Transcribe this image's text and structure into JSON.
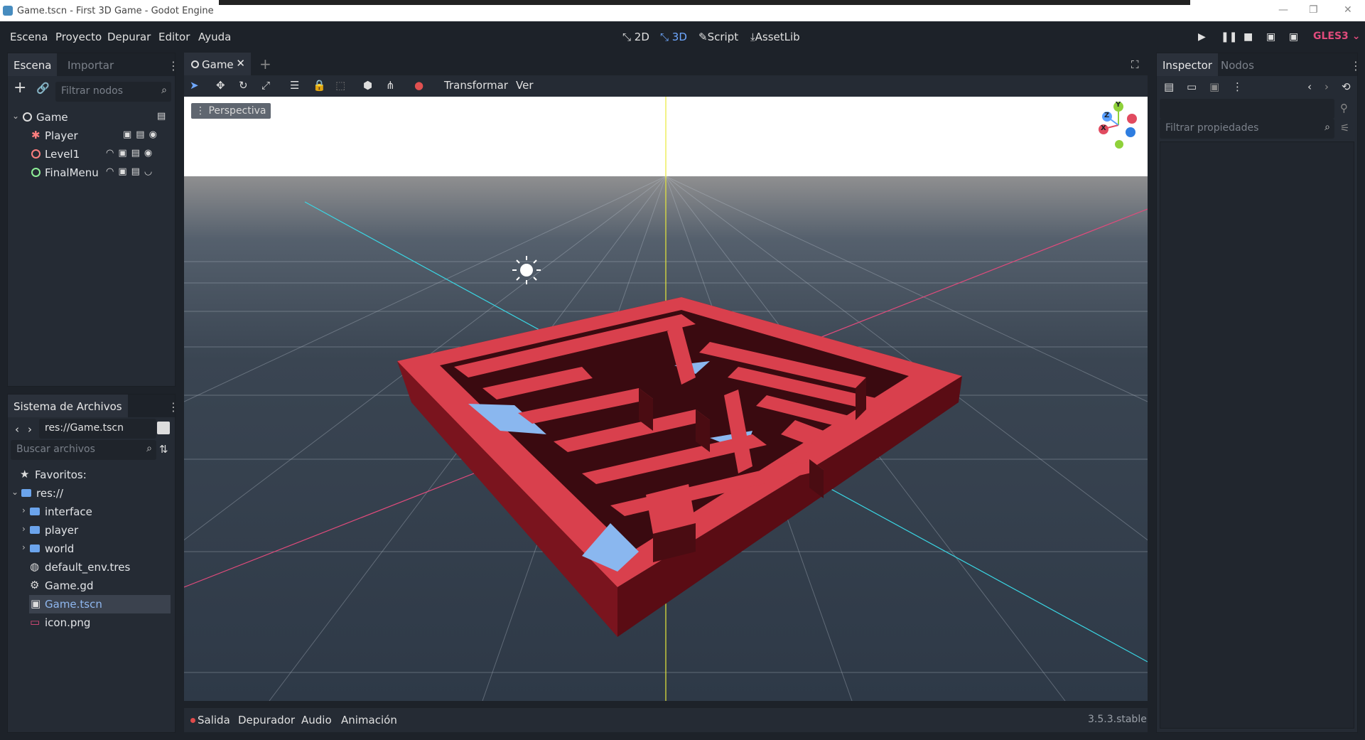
{
  "window": {
    "title": "Game.tscn - First 3D Game - Godot Engine",
    "controls": [
      "—",
      "❐",
      "✕"
    ]
  },
  "menu": [
    "Escena",
    "Proyecto",
    "Depurar",
    "Editor",
    "Ayuda"
  ],
  "workspaces": {
    "w2d": "2D",
    "w3d": "3D",
    "script": "Script",
    "assetlib": "AssetLib"
  },
  "renderer": "GLES3",
  "scene_panel": {
    "tabs": [
      "Escena",
      "Importar"
    ],
    "filter_placeholder": "Filtrar nodos",
    "tree": [
      {
        "label": "Game",
        "indent": 0
      },
      {
        "label": "Player",
        "indent": 1
      },
      {
        "label": "Level1",
        "indent": 1
      },
      {
        "label": "FinalMenu",
        "indent": 1
      }
    ]
  },
  "filesystem": {
    "title": "Sistema de Archivos",
    "path": "res://Game.tscn",
    "search_placeholder": "Buscar archivos",
    "items": [
      {
        "label": "Favoritos:"
      },
      {
        "label": "res://"
      },
      {
        "label": "interface"
      },
      {
        "label": "player"
      },
      {
        "label": "world"
      },
      {
        "label": "default_env.tres"
      },
      {
        "label": "Game.gd"
      },
      {
        "label": "Game.tscn"
      },
      {
        "label": "icon.png"
      }
    ]
  },
  "editor": {
    "tab": "Game",
    "toolbar_transform": "Transformar",
    "toolbar_view": "Ver",
    "perspective": "Perspectiva",
    "gizmo": {
      "y": "Y",
      "z": "Z",
      "x": "X"
    }
  },
  "inspector": {
    "tabs": [
      "Inspector",
      "Nodos"
    ],
    "filter_placeholder": "Filtrar propiedades"
  },
  "bottom": {
    "tabs": [
      "Salida",
      "Depurador",
      "Audio",
      "Animación"
    ],
    "version": "3.5.3.stable"
  },
  "colors": {
    "accent": "#6fa8ff",
    "maze": "#d9404d",
    "renderer": "#e14b7c"
  }
}
